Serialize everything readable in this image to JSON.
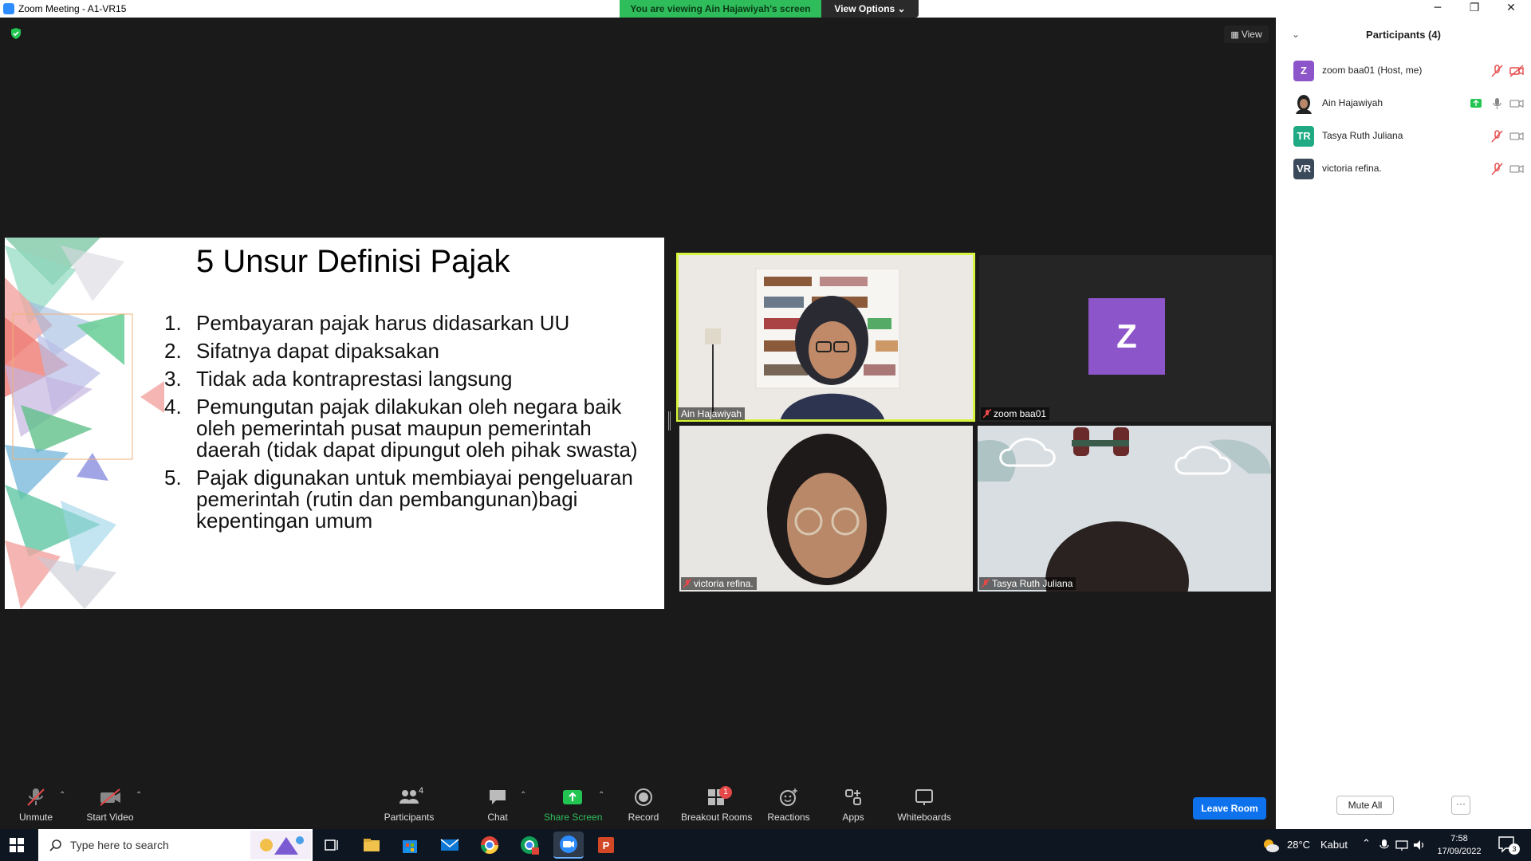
{
  "window": {
    "title": "Zoom Meeting - A1-VR15",
    "minimize": "─",
    "restore": "❐",
    "close": "✕"
  },
  "banner": {
    "viewing": "You are viewing Ain Hajawiyah's screen",
    "view_options": "View Options ⌄"
  },
  "view_button": "View",
  "slide": {
    "title": "5 Unsur Definisi Pajak",
    "items": [
      {
        "num": "1.",
        "text": "Pembayaran pajak harus didasarkan UU"
      },
      {
        "num": "2.",
        "text": "Sifatnya dapat dipaksakan"
      },
      {
        "num": "3.",
        "text": "Tidak ada kontraprestasi langsung"
      },
      {
        "num": "4.",
        "text": "Pemungutan pajak dilakukan oleh negara baik oleh pemerintah pusat maupun pemerintah daerah (tidak dapat dipungut oleh pihak swasta)"
      },
      {
        "num": "5.",
        "text": "Pajak digunakan untuk membiayai pengeluaran pemerintah (rutin dan pembangunan)bagi kepentingan umum"
      }
    ]
  },
  "tiles": {
    "ain": "Ain Hajawiyah",
    "zoom": "zoom baa01",
    "zoom_avatar": "Z",
    "victoria": "victoria refina.",
    "tasya": "Tasya Ruth Juliana"
  },
  "toolbar": {
    "unmute": "Unmute",
    "start_video": "Start Video",
    "participants": "Participants",
    "participants_count": "4",
    "chat": "Chat",
    "share_screen": "Share Screen",
    "record": "Record",
    "breakout_rooms": "Breakout Rooms",
    "breakout_badge": "1",
    "reactions": "Reactions",
    "apps": "Apps",
    "whiteboards": "Whiteboards",
    "leave_room": "Leave Room"
  },
  "panel": {
    "title": "Participants (4)",
    "participants": [
      {
        "initials": "Z",
        "name": "zoom baa01 (Host, me)",
        "color": "#8c55c9"
      },
      {
        "initials": "",
        "name": "Ain Hajawiyah",
        "color": "#333333"
      },
      {
        "initials": "TR",
        "name": "Tasya Ruth Juliana",
        "color": "#1faa83"
      },
      {
        "initials": "VR",
        "name": "victoria refina.",
        "color": "#3a4a5a"
      }
    ],
    "mute_all": "Mute All",
    "more": "···"
  },
  "taskbar": {
    "search_placeholder": "Type here to search",
    "temperature": "28°C",
    "weather": "Kabut",
    "time": "7:58",
    "date": "17/09/2022",
    "notifications": "3"
  }
}
